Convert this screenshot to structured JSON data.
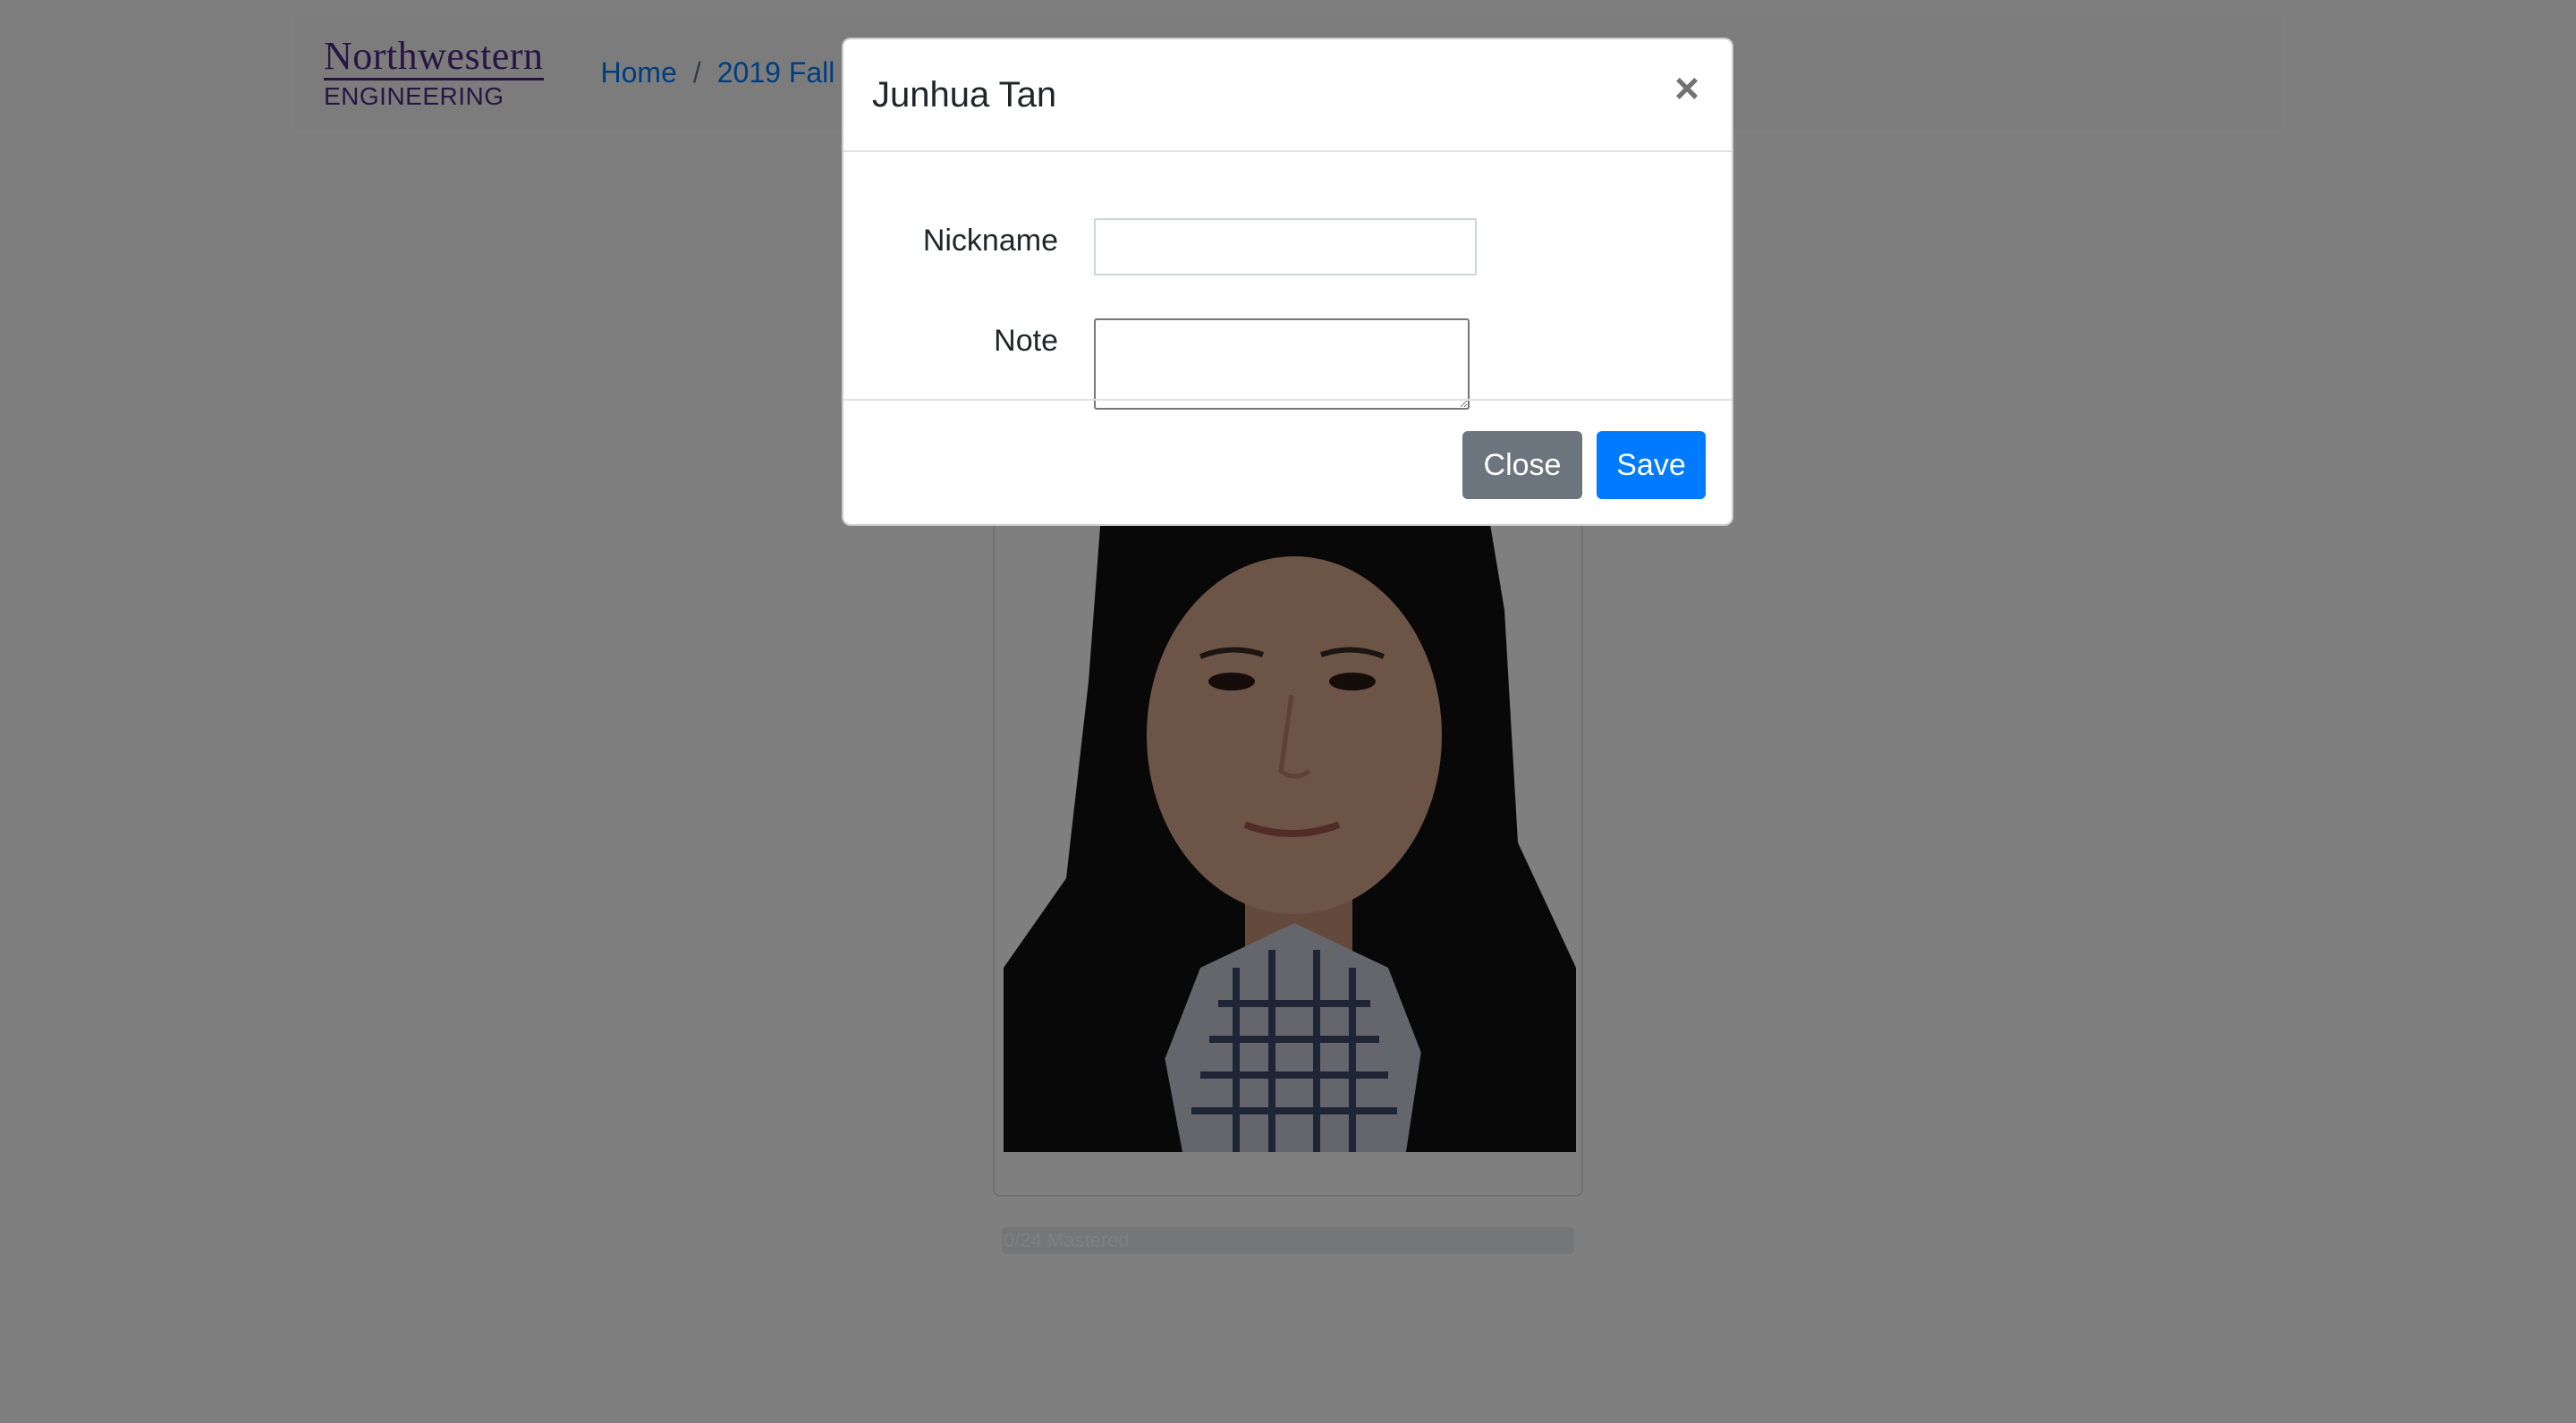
{
  "navbar": {
    "brand_top": "Northwestern",
    "brand_bottom": "ENGINEERING",
    "breadcrumbs": [
      {
        "label": "Home"
      },
      {
        "label": "2019 Fall"
      }
    ],
    "separator": "/"
  },
  "card": {
    "photo_alt": "Junhua Tan"
  },
  "progress": {
    "label": "0/24 Mastered",
    "value": 0,
    "total": 24
  },
  "modal": {
    "title": "Junhua Tan",
    "close_symbol": "×",
    "nickname_label": "Nickname",
    "nickname_value": "",
    "note_label": "Note",
    "note_value": "",
    "close_button": "Close",
    "save_button": "Save"
  },
  "colors": {
    "brand_purple": "#4e2a84",
    "link_blue": "#007bff",
    "secondary_gray": "#6c757d",
    "primary_blue": "#007bff"
  }
}
